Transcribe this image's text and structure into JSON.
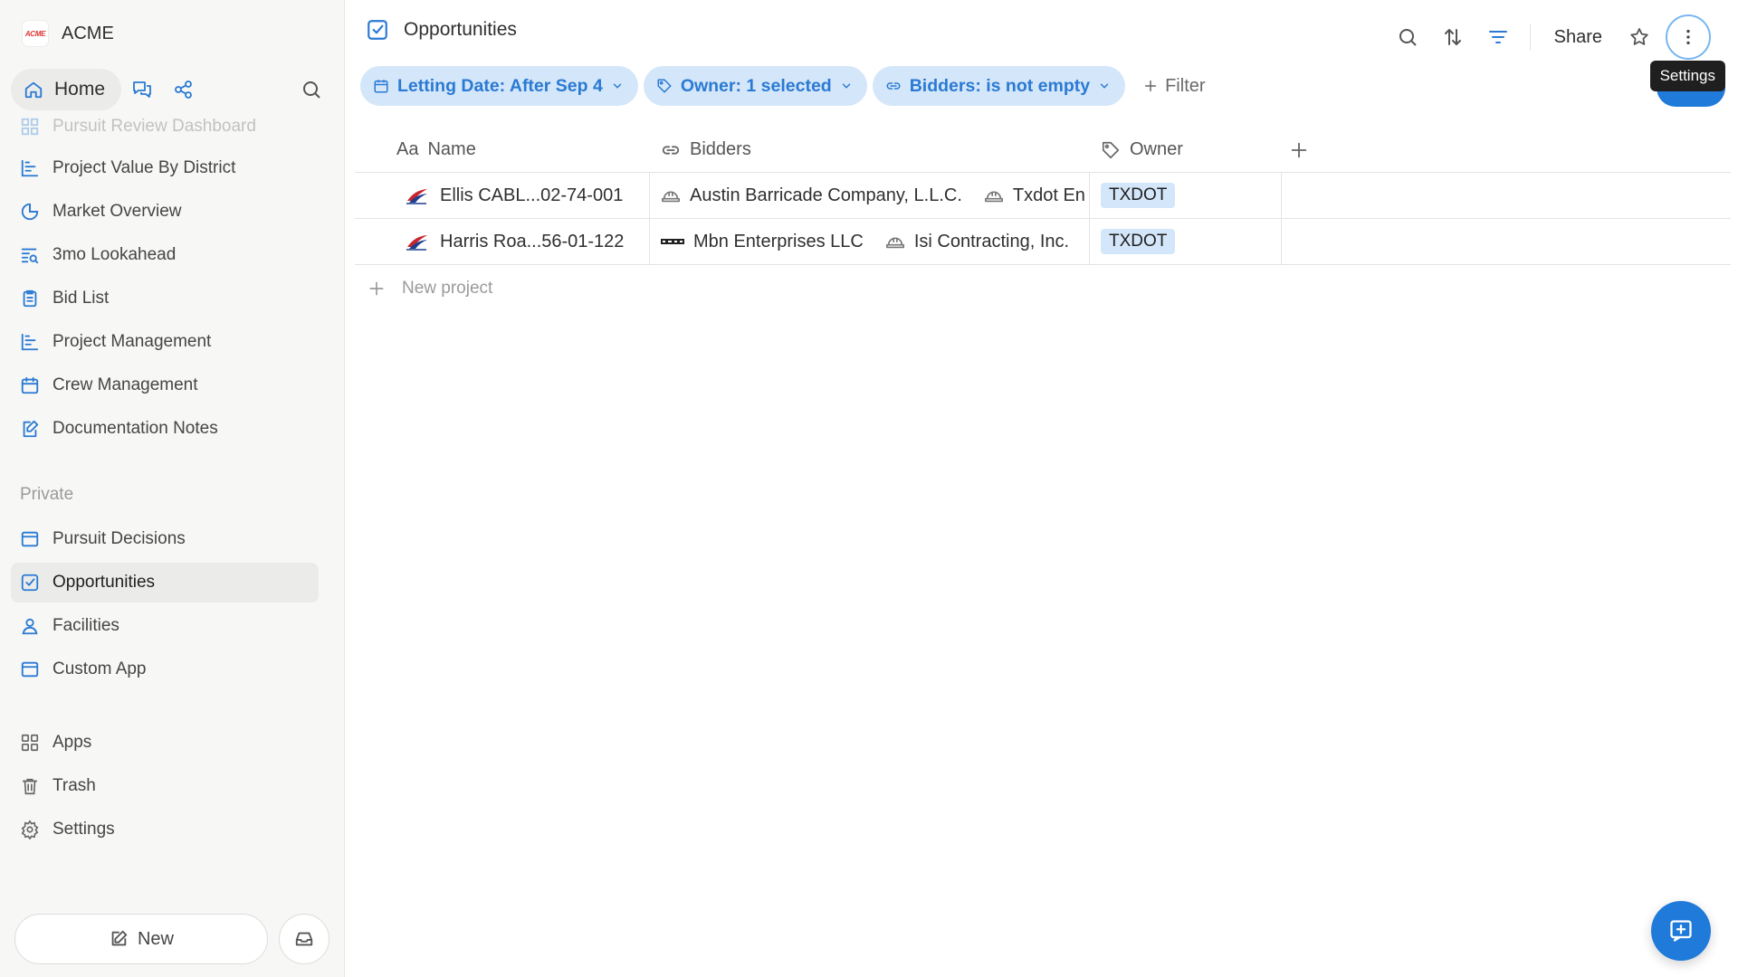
{
  "workspace": {
    "name": "ACME",
    "logo_text": "ACME"
  },
  "topnav": {
    "home_label": "Home"
  },
  "sidebar": {
    "faded_item": "Pursuit Review Dashboard",
    "items": [
      {
        "label": "Project Value By District",
        "icon": "bar-chart-icon"
      },
      {
        "label": "Market Overview",
        "icon": "pie-chart-icon"
      },
      {
        "label": "3mo Lookahead",
        "icon": "list-search-icon"
      },
      {
        "label": "Bid List",
        "icon": "clipboard-icon"
      },
      {
        "label": "Project Management",
        "icon": "bar-chart-icon"
      },
      {
        "label": "Crew Management",
        "icon": "calendar-icon"
      },
      {
        "label": "Documentation Notes",
        "icon": "edit-note-icon"
      }
    ],
    "private_label": "Private",
    "private_items": [
      {
        "label": "Pursuit Decisions",
        "icon": "window-icon"
      },
      {
        "label": "Opportunities",
        "icon": "checkbox-icon",
        "active": true
      },
      {
        "label": "Facilities",
        "icon": "person-icon"
      },
      {
        "label": "Custom App",
        "icon": "window-icon"
      }
    ],
    "footer_items": [
      {
        "label": "Apps",
        "icon": "apps-grid-icon"
      },
      {
        "label": "Trash",
        "icon": "trash-icon"
      },
      {
        "label": "Settings",
        "icon": "gear-icon"
      }
    ],
    "new_label": "New"
  },
  "header": {
    "title": "Opportunities",
    "share_label": "Share",
    "tooltip": "Settings"
  },
  "filters": [
    {
      "label": "Letting Date: After Sep 4"
    },
    {
      "label": "Owner: 1 selected"
    },
    {
      "label": "Bidders: is not empty"
    }
  ],
  "add_filter_label": "Filter",
  "table": {
    "columns": [
      {
        "label": "Name",
        "prefix": "Aa"
      },
      {
        "label": "Bidders"
      },
      {
        "label": "Owner"
      }
    ],
    "rows": [
      {
        "name": "Ellis CABL...02-74-001",
        "bidders": [
          "Austin Barricade Company, L.L.C.",
          "Txdot En"
        ],
        "owner": "TXDOT"
      },
      {
        "name": "Harris Roa...56-01-122",
        "bidders": [
          "Mbn Enterprises LLC",
          "Isi Contracting, Inc."
        ],
        "owner": "TXDOT"
      }
    ],
    "new_row_label": "New project"
  },
  "colors": {
    "accent": "#1f7ad9",
    "chip_bg": "#d4e6f9",
    "chip_text": "#2a7ad3"
  }
}
